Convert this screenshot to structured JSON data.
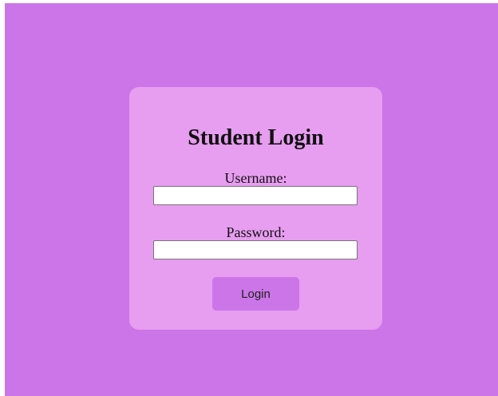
{
  "login": {
    "title": "Student Login",
    "username_label": "Username:",
    "username_value": "",
    "password_label": "Password:",
    "password_value": "",
    "button_label": "Login"
  },
  "colors": {
    "background": "#cb75e8",
    "card": "#e79df0",
    "button": "#cb75e8"
  }
}
